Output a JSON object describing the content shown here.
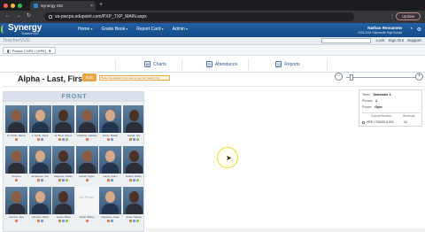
{
  "browser": {
    "tab_title": "Synergy SIS",
    "tab_close": "×",
    "new_tab": "+",
    "url": "va-pwcps.edupoint.com/PXP_TXP_MAIN.aspx",
    "update_label": "Update",
    "nav_back": "←",
    "nav_forward": "→",
    "reload": "↻",
    "menu": "⋮"
  },
  "header": {
    "logo": "Synergy",
    "logo_sub": "TeacherVUE",
    "menu": [
      "Home",
      "Grade Book",
      "Report Card",
      "Admin"
    ],
    "user_name": "Nathan Remamew",
    "user_school": "2023-2024 Gainesville High School",
    "app_title": "TeacherVUE",
    "links": [
      "Lock",
      "Sign Out",
      "Support"
    ]
  },
  "period": {
    "selected": "Period 2 HPE I (HPE)"
  },
  "subnav": {
    "tiles": [
      "Charts",
      "Attendance",
      "Reports"
    ],
    "icons": [
      "chart-icon",
      "attendance-icon",
      "reports-icon"
    ]
  },
  "page": {
    "title": "Alpha - Last, First",
    "edit_label": "Edit",
    "notice": "Please drag students to the seats to save their seating chart",
    "zoom_out": "−",
    "zoom_in": "+",
    "zoom_level": 0.05
  },
  "seating": {
    "front_label": "FRONT",
    "seats": [
      {
        "name": "M. Smith, Darius",
        "photo": "student"
      },
      {
        "name": "A. Smith, Dana",
        "photo": "student"
      },
      {
        "name": "W. Bess, Simon",
        "photo": "student"
      },
      {
        "name": "Crawford, Isabella",
        "photo": "student"
      },
      {
        "name": "Davis, Malaki",
        "photo": "student"
      },
      {
        "name": "Garcia, Nia",
        "photo": "student"
      },
      {
        "name": "Grayson",
        "photo": "student"
      },
      {
        "name": "Henderson, Kai",
        "photo": "student"
      },
      {
        "name": "Hargrove, Ashley",
        "photo": "student"
      },
      {
        "name": "Harrell, Tayler",
        "photo": "student"
      },
      {
        "name": "Harris, Aiden",
        "photo": "student"
      },
      {
        "name": "Hebert, Ridley",
        "photo": "student"
      },
      {
        "name": "Jackson, Alex",
        "photo": "student"
      },
      {
        "name": "Johnson, Olivia",
        "photo": "student"
      },
      {
        "name": "Jones, Maya",
        "photo": "student"
      },
      {
        "name": "Kader, Bailey",
        "photo": "no-photo",
        "no_photo_label": "No Photo"
      },
      {
        "name": "Kalyanam, Isaac",
        "photo": "student"
      },
      {
        "name": "Jones, Nathan",
        "photo": "student"
      }
    ]
  },
  "info": {
    "term_label": "Term:",
    "term_value": "Semester 1",
    "period_label": "Period:",
    "period_value": "2",
    "room_label": "Room:",
    "room_value": "Gym",
    "col_course": "Course/Section",
    "col_students": "Students",
    "row_course": "HPE I  730020-0-001",
    "row_students": "34"
  },
  "colors": {
    "header_blue": "#1a5797",
    "edit_orange": "#e9a643",
    "link_blue": "#2f5f9a"
  }
}
